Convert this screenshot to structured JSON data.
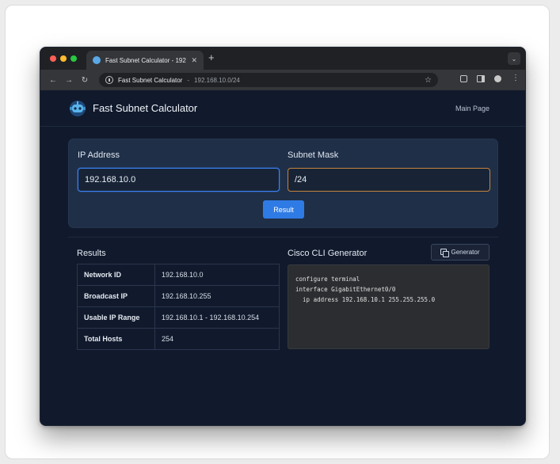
{
  "browser": {
    "tab_title": "Fast Subnet Calculator - 192.",
    "tab_close": "✕",
    "new_tab": "+",
    "tab_menu": "⌄",
    "url_host": "Fast Subnet Calculator",
    "url_sep": "-",
    "url_path": "192.168.10.0/24",
    "back": "←",
    "forward": "→",
    "reload": "↻",
    "star": "☆",
    "menu": "⋮"
  },
  "app": {
    "title": "Fast Subnet Calculator",
    "nav_link": "Main Page"
  },
  "form": {
    "ip_label": "IP Address",
    "ip_value": "192.168.10.0",
    "mask_label": "Subnet Mask",
    "mask_value": "/24",
    "submit_label": "Result"
  },
  "results": {
    "heading": "Results",
    "rows": [
      {
        "key": "Network ID",
        "value": "192.168.10.0"
      },
      {
        "key": "Broadcast IP",
        "value": "192.168.10.255"
      },
      {
        "key": "Usable IP Range",
        "value": "192.168.10.1 - 192.168.10.254"
      },
      {
        "key": "Total Hosts",
        "value": "254"
      }
    ]
  },
  "cli": {
    "heading": "Cisco CLI Generator",
    "generator_label": "Generator",
    "lines": [
      "configure terminal",
      "interface GigabitEthernet0/0",
      "  ip address 192.168.10.1 255.255.255.0"
    ]
  },
  "colors": {
    "accent": "#2f7be5",
    "focus_border": "#3b82f6",
    "mask_border": "#c58440",
    "page_bg": "#111a2c",
    "panel_bg": "#1f2f47"
  }
}
